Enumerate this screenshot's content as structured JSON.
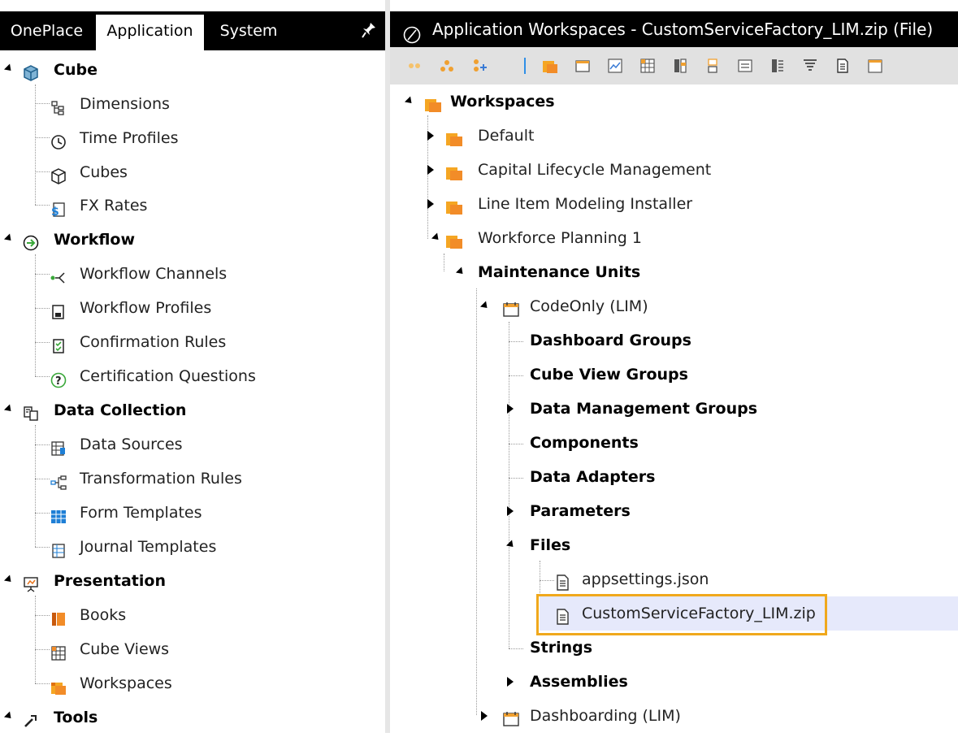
{
  "left_panel": {
    "tabs": [
      {
        "label": "OnePlace",
        "active": false
      },
      {
        "label": "Application",
        "active": true
      },
      {
        "label": "System",
        "active": false
      }
    ],
    "pin_icon": "pin-icon",
    "sections": [
      {
        "label": "Cube",
        "icon": "cube-icon",
        "items": [
          {
            "label": "Dimensions",
            "icon": "dimensions-icon"
          },
          {
            "label": "Time Profiles",
            "icon": "clock-icon"
          },
          {
            "label": "Cubes",
            "icon": "cube-icon"
          },
          {
            "label": "FX Rates",
            "icon": "fx-rates-icon"
          }
        ]
      },
      {
        "label": "Workflow",
        "icon": "workflow-arrow-icon",
        "items": [
          {
            "label": "Workflow Channels",
            "icon": "workflow-channels-icon"
          },
          {
            "label": "Workflow Profiles",
            "icon": "workflow-profiles-icon"
          },
          {
            "label": "Confirmation Rules",
            "icon": "confirmation-rules-icon"
          },
          {
            "label": "Certification Questions",
            "icon": "question-icon"
          }
        ]
      },
      {
        "label": "Data Collection",
        "icon": "data-collection-icon",
        "items": [
          {
            "label": "Data Sources",
            "icon": "data-sources-icon"
          },
          {
            "label": "Transformation Rules",
            "icon": "transformation-rules-icon"
          },
          {
            "label": "Form Templates",
            "icon": "form-templates-icon"
          },
          {
            "label": "Journal Templates",
            "icon": "journal-templates-icon"
          }
        ]
      },
      {
        "label": "Presentation",
        "icon": "presentation-icon",
        "items": [
          {
            "label": "Books",
            "icon": "books-icon"
          },
          {
            "label": "Cube Views",
            "icon": "cube-views-icon"
          },
          {
            "label": "Workspaces",
            "icon": "workspaces-icon"
          }
        ]
      },
      {
        "label": "Tools",
        "icon": "tools-icon",
        "items": []
      }
    ]
  },
  "right_panel": {
    "title": "Application Workspaces - CustomServiceFactory_LIM.zip (File)",
    "toolbar_icons": [
      "dots-icon",
      "group-icon",
      "add-icon",
      "workspace-icon",
      "maintenance-unit-icon",
      "chart-icon",
      "grid-icon",
      "columns-icon",
      "stack-icon",
      "form-icon",
      "list-icon",
      "filter-icon",
      "document-icon",
      "calendar-icon"
    ],
    "tree": {
      "root": "Workspaces",
      "workspaces": [
        "Default",
        "Capital Lifecycle Management",
        "Line Item Modeling Installer",
        "Workforce Planning 1"
      ],
      "maintenance_units": "Maintenance Units",
      "unit_code_only": "CodeOnly (LIM)",
      "groups": [
        "Dashboard Groups",
        "Cube View Groups",
        "Data Management Groups",
        "Components",
        "Data Adapters",
        "Parameters",
        "Files"
      ],
      "files": [
        "appsettings.json",
        "CustomServiceFactory_LIM.zip"
      ],
      "after_files": [
        "Strings",
        "Assemblies"
      ],
      "unit_dashboarding": "Dashboarding (LIM)"
    },
    "colors": {
      "selection_border": "#f0a81c",
      "selection_fill": "#e6e9fb",
      "workspace_orange": "#f28c28"
    }
  }
}
